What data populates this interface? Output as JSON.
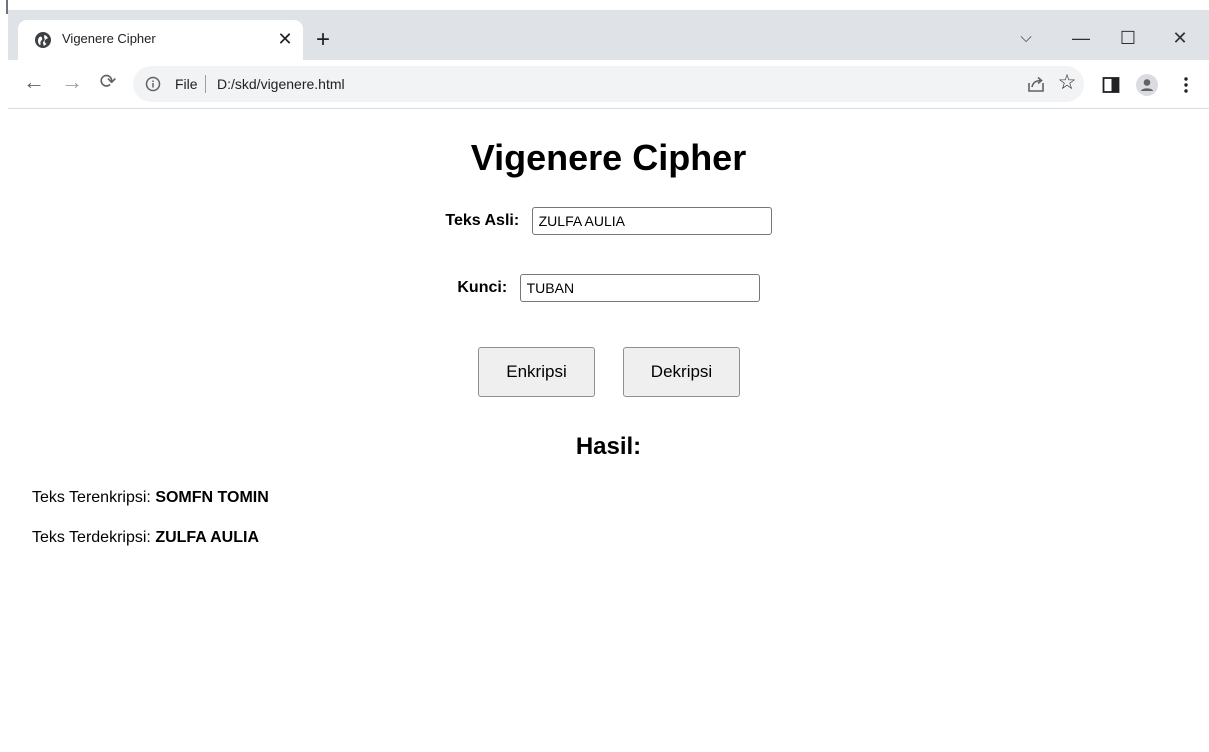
{
  "browser": {
    "tab_title": "Vigenere Cipher",
    "url_scheme": "File",
    "url": "D:/skd/vigenere.html"
  },
  "page": {
    "heading": "Vigenere Cipher",
    "plain_label": "Teks Asli:",
    "plain_value": "ZULFA AULIA",
    "key_label": "Kunci:",
    "key_value": "TUBAN",
    "encrypt_button": "Enkripsi",
    "decrypt_button": "Dekripsi",
    "result_heading": "Hasil:",
    "encrypted_label": "Teks Terenkripsi:",
    "encrypted_value": "SOMFN TOMIN",
    "decrypted_label": "Teks Terdekripsi:",
    "decrypted_value": "ZULFA AULIA"
  },
  "icons": {
    "favicon": "globe-icon",
    "tab_close": "close-icon",
    "new_tab": "plus-icon",
    "back": "arrow-left-icon",
    "forward": "arrow-right-icon",
    "reload": "reload-icon",
    "info": "info-icon",
    "share": "share-icon",
    "bookmark": "star-icon",
    "side_panel": "side-panel-icon",
    "profile": "profile-icon",
    "menu": "kebab-menu-icon",
    "tab_search": "chevron-down-icon",
    "minimize": "minimize-icon",
    "maximize": "maximize-icon",
    "close_window": "close-window-icon"
  }
}
